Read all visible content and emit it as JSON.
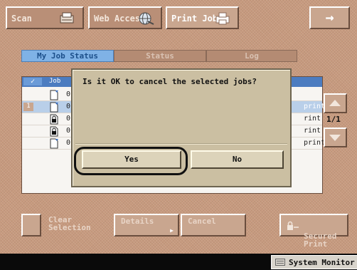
{
  "top_tabs": [
    {
      "label": "Scan",
      "icon": "scanner-icon"
    },
    {
      "label": "Web Access",
      "icon": "globe-icon"
    },
    {
      "label": "Print Job",
      "icon": "printer-icon",
      "active": true
    }
  ],
  "arrow_button": {
    "label": "→"
  },
  "sub_tabs": [
    "My Job Status",
    "Status",
    "Log"
  ],
  "list": {
    "header_check": "✓",
    "header_job": "Job",
    "rows": [
      {
        "num": "",
        "icon": "document-icon",
        "value": "0",
        "right": ""
      },
      {
        "num": "1",
        "icon": "document-icon",
        "value": "0",
        "right": "print",
        "selected": true
      },
      {
        "num": "",
        "icon": "secured-document-icon",
        "value": "0",
        "right": "rint"
      },
      {
        "num": "",
        "icon": "secured-document-icon",
        "value": "0",
        "right": "rint"
      },
      {
        "num": "",
        "icon": "document-icon",
        "value": "0",
        "right": "print"
      }
    ]
  },
  "pager": {
    "text": "1/1"
  },
  "bottom_buttons": {
    "clear": "Clear\nSelection",
    "details": "Details",
    "cancel": "Cancel",
    "secured_print": "Secured\nPrint"
  },
  "dialog": {
    "message": "Is it OK to cancel the selected jobs?",
    "yes_label": "Yes",
    "no_label": "No"
  },
  "status_bar": {
    "system_monitor": "System Monitor"
  },
  "colors": {
    "background": "#c79a7e",
    "selected_tab": "#7fb2e6",
    "dialog": "#cbbfa2"
  }
}
